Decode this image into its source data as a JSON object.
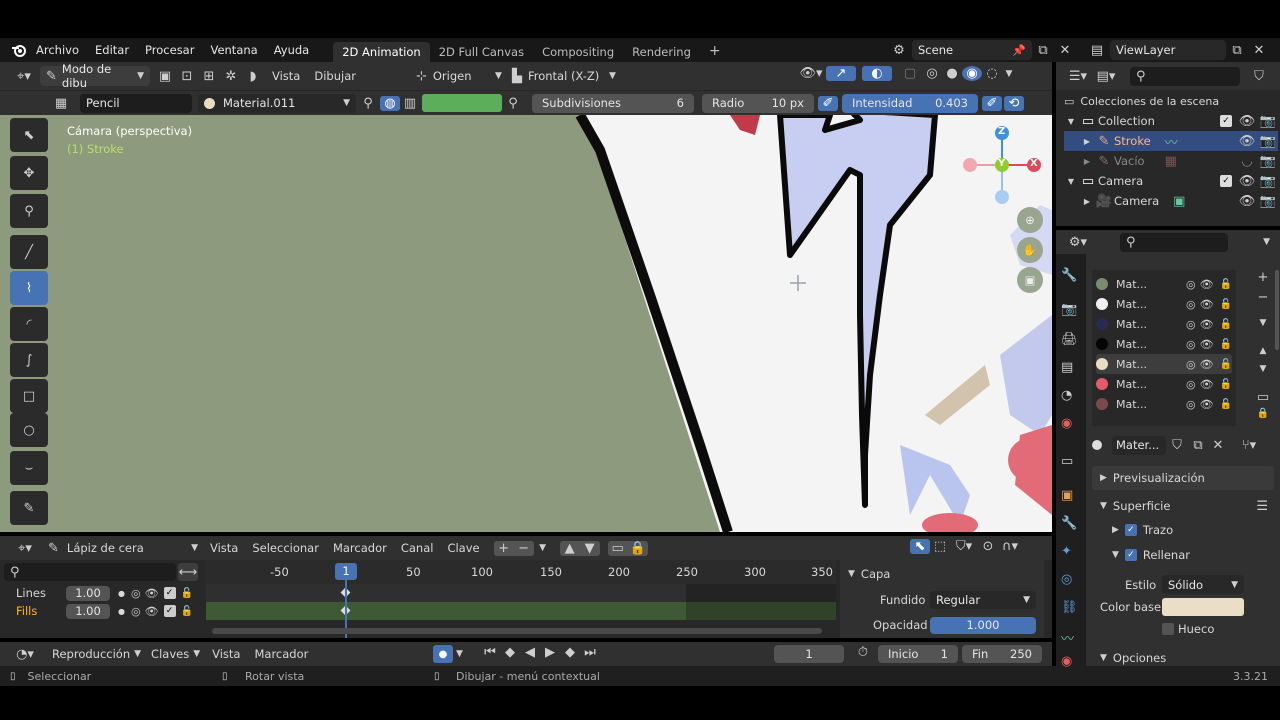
{
  "menubar": {
    "items": [
      "Archivo",
      "Editar",
      "Procesar",
      "Ventana",
      "Ayuda"
    ],
    "workspaces": [
      "2D Animation",
      "2D Full Canvas",
      "Compositing",
      "Rendering"
    ],
    "active_workspace": "2D Animation",
    "add_workspace": "+",
    "scene": "Scene",
    "view_layer": "ViewLayer"
  },
  "viewport_header": {
    "mode": "Modo de dibu",
    "view": "Vista",
    "draw": "Dibujar",
    "origin": "Origen",
    "orientation": "Frontal (X-Z)"
  },
  "tool_settings": {
    "brush": "Pencil",
    "material": "Material.011",
    "color_hex": "#5cae5a",
    "subdiv_label": "Subdivisiones",
    "subdiv_value": "6",
    "radius_label": "Radio",
    "radius_value": "10 px",
    "strength_label": "Intensidad",
    "strength_value": "0.403"
  },
  "viewport": {
    "camera_label": "Cámara (perspectiva)",
    "object_label": "(1) Stroke",
    "gizmo": {
      "z": "Z",
      "y": "Y",
      "x": "X"
    }
  },
  "outliner": {
    "title": "Colecciones de la escena",
    "rows": [
      {
        "name": "Collection"
      },
      {
        "name": "Stroke"
      },
      {
        "name": "Vacío"
      },
      {
        "name": "Camera"
      },
      {
        "name": "Camera"
      }
    ]
  },
  "materials": {
    "slots": [
      {
        "name": "Mat...",
        "color": "#7d8a73"
      },
      {
        "name": "Mat...",
        "color": "#f0f0f0"
      },
      {
        "name": "Mat...",
        "color": "#2b2a52"
      },
      {
        "name": "Mat...",
        "color": "#050505"
      },
      {
        "name": "Mat...",
        "color": "#e8dcc1"
      },
      {
        "name": "Mat...",
        "color": "#e35a6a"
      },
      {
        "name": "Mat...",
        "color": "#7a4a4a"
      }
    ],
    "active_material": "Mater..."
  },
  "properties": {
    "preview": "Previsualización",
    "surface": "Superficie",
    "stroke": "Trazo",
    "fill": "Rellenar",
    "style_label": "Estilo",
    "style_value": "Sólido",
    "base_color_label": "Color base",
    "base_color": "#eadfc6",
    "holdout": "Hueco",
    "options": "Opciones"
  },
  "dopesheet": {
    "mode": "Lápiz de cera",
    "menus": [
      "Vista",
      "Seleccionar",
      "Marcador",
      "Canal",
      "Clave"
    ],
    "ruler": [
      "-50",
      "1",
      "50",
      "100",
      "150",
      "200",
      "250",
      "300",
      "350"
    ],
    "current_frame_label": "1",
    "layers": [
      {
        "name": "Lines",
        "opacity": "1.00"
      },
      {
        "name": "Fills",
        "opacity": "1.00"
      }
    ],
    "layer_panel": {
      "title": "Capa",
      "blend_label": "Fundido",
      "blend_value": "Regular",
      "opacity_label": "Opacidad",
      "opacity_value": "1.000"
    }
  },
  "timeline": {
    "menus": [
      "Reproducción",
      "Claves",
      "Vista",
      "Marcador"
    ],
    "frame": "1",
    "start_label": "Inicio",
    "start": "1",
    "end_label": "Fin",
    "end": "250"
  },
  "statusbar": {
    "select": "Seleccionar",
    "rotate": "Rotar vista",
    "draw_menu": "Dibujar - menú contextual",
    "version": "3.3.21"
  }
}
